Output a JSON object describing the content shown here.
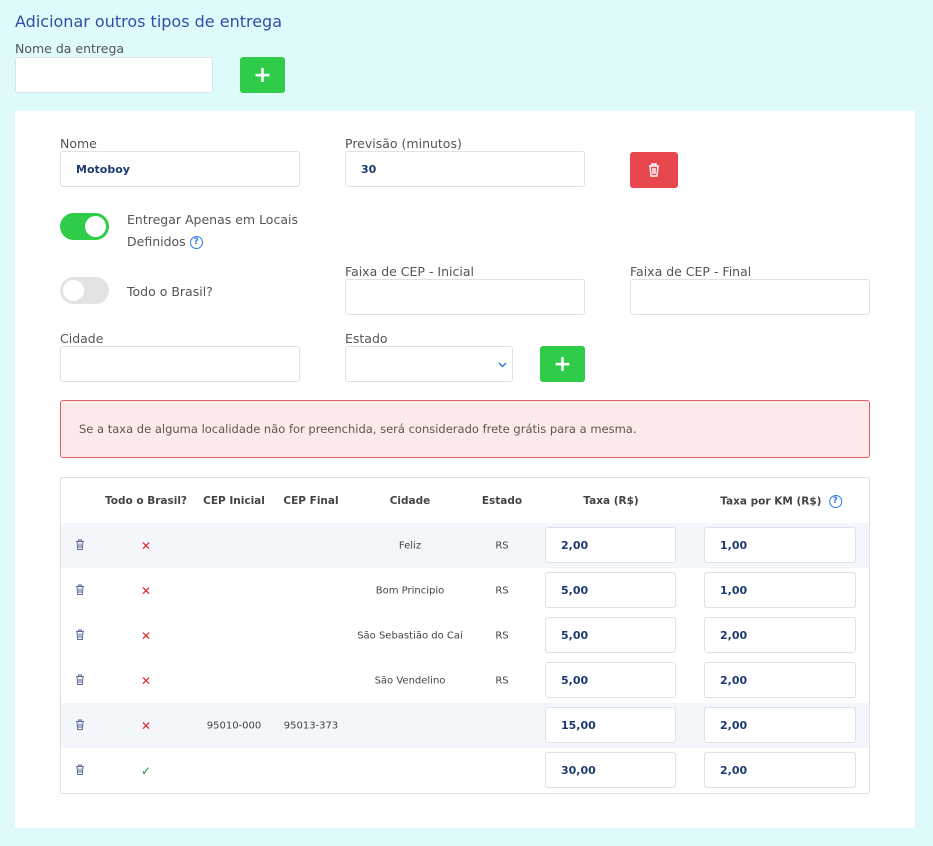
{
  "header": {
    "title": "Adicionar outros tipos de entrega",
    "name_label": "Nome da entrega",
    "name_value": "",
    "add_label": "+"
  },
  "form": {
    "nome_label": "Nome",
    "nome_value": "Motoboy",
    "previsao_label": "Previsão (minutos)",
    "previsao_value": "30",
    "apenas_locais_label_1": "Entregar Apenas em Locais",
    "apenas_locais_label_2": "Definidos",
    "apenas_locais_on": true,
    "todo_brasil_label": "Todo o Brasil?",
    "todo_brasil_on": false,
    "cep_inicial_label": "Faixa de CEP - Inicial",
    "cep_inicial_value": "",
    "cep_final_label": "Faixa de CEP - Final",
    "cep_final_value": "",
    "cidade_label": "Cidade",
    "cidade_value": "",
    "estado_label": "Estado",
    "estado_value": "",
    "add_label": "+",
    "help": "?"
  },
  "alert": "Se a taxa de alguma localidade não for preenchida, será considerado frete grátis para a mesma.",
  "table": {
    "headers": [
      "Todo o Brasil?",
      "CEP Inicial",
      "CEP Final",
      "Cidade",
      "Estado",
      "Taxa (R$)",
      "Taxa por KM (R$)"
    ],
    "rows": [
      {
        "todo": "✕",
        "cep_ini": "",
        "cep_fim": "",
        "cidade": "Feliz",
        "estado": "RS",
        "taxa": "2,00",
        "km": "1,00"
      },
      {
        "todo": "✕",
        "cep_ini": "",
        "cep_fim": "",
        "cidade": "Bom Principio",
        "estado": "RS",
        "taxa": "5,00",
        "km": "1,00"
      },
      {
        "todo": "✕",
        "cep_ini": "",
        "cep_fim": "",
        "cidade": "São Sebastião do Caí",
        "estado": "RS",
        "taxa": "5,00",
        "km": "2,00"
      },
      {
        "todo": "✕",
        "cep_ini": "",
        "cep_fim": "",
        "cidade": "São Vendelino",
        "estado": "RS",
        "taxa": "5,00",
        "km": "2,00"
      },
      {
        "todo": "✕",
        "cep_ini": "95010-000",
        "cep_fim": "95013-373",
        "cidade": "",
        "estado": "",
        "taxa": "15,00",
        "km": "2,00"
      },
      {
        "todo": "✓",
        "cep_ini": "",
        "cep_fim": "",
        "cidade": "",
        "estado": "",
        "taxa": "30,00",
        "km": "2,00"
      }
    ]
  },
  "colors": {
    "green": "#2ecc48",
    "red": "#e8474e",
    "accent": "#2f4fa8"
  }
}
